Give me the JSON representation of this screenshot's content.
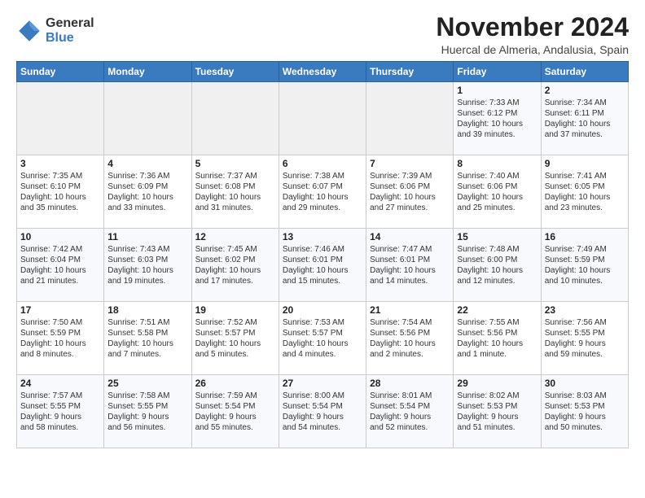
{
  "header": {
    "logo_general": "General",
    "logo_blue": "Blue",
    "month_title": "November 2024",
    "location": "Huercal de Almeria, Andalusia, Spain"
  },
  "days_of_week": [
    "Sunday",
    "Monday",
    "Tuesday",
    "Wednesday",
    "Thursday",
    "Friday",
    "Saturday"
  ],
  "weeks": [
    [
      {
        "day": "",
        "info": ""
      },
      {
        "day": "",
        "info": ""
      },
      {
        "day": "",
        "info": ""
      },
      {
        "day": "",
        "info": ""
      },
      {
        "day": "",
        "info": ""
      },
      {
        "day": "1",
        "info": "Sunrise: 7:33 AM\nSunset: 6:12 PM\nDaylight: 10 hours\nand 39 minutes."
      },
      {
        "day": "2",
        "info": "Sunrise: 7:34 AM\nSunset: 6:11 PM\nDaylight: 10 hours\nand 37 minutes."
      }
    ],
    [
      {
        "day": "3",
        "info": "Sunrise: 7:35 AM\nSunset: 6:10 PM\nDaylight: 10 hours\nand 35 minutes."
      },
      {
        "day": "4",
        "info": "Sunrise: 7:36 AM\nSunset: 6:09 PM\nDaylight: 10 hours\nand 33 minutes."
      },
      {
        "day": "5",
        "info": "Sunrise: 7:37 AM\nSunset: 6:08 PM\nDaylight: 10 hours\nand 31 minutes."
      },
      {
        "day": "6",
        "info": "Sunrise: 7:38 AM\nSunset: 6:07 PM\nDaylight: 10 hours\nand 29 minutes."
      },
      {
        "day": "7",
        "info": "Sunrise: 7:39 AM\nSunset: 6:06 PM\nDaylight: 10 hours\nand 27 minutes."
      },
      {
        "day": "8",
        "info": "Sunrise: 7:40 AM\nSunset: 6:06 PM\nDaylight: 10 hours\nand 25 minutes."
      },
      {
        "day": "9",
        "info": "Sunrise: 7:41 AM\nSunset: 6:05 PM\nDaylight: 10 hours\nand 23 minutes."
      }
    ],
    [
      {
        "day": "10",
        "info": "Sunrise: 7:42 AM\nSunset: 6:04 PM\nDaylight: 10 hours\nand 21 minutes."
      },
      {
        "day": "11",
        "info": "Sunrise: 7:43 AM\nSunset: 6:03 PM\nDaylight: 10 hours\nand 19 minutes."
      },
      {
        "day": "12",
        "info": "Sunrise: 7:45 AM\nSunset: 6:02 PM\nDaylight: 10 hours\nand 17 minutes."
      },
      {
        "day": "13",
        "info": "Sunrise: 7:46 AM\nSunset: 6:01 PM\nDaylight: 10 hours\nand 15 minutes."
      },
      {
        "day": "14",
        "info": "Sunrise: 7:47 AM\nSunset: 6:01 PM\nDaylight: 10 hours\nand 14 minutes."
      },
      {
        "day": "15",
        "info": "Sunrise: 7:48 AM\nSunset: 6:00 PM\nDaylight: 10 hours\nand 12 minutes."
      },
      {
        "day": "16",
        "info": "Sunrise: 7:49 AM\nSunset: 5:59 PM\nDaylight: 10 hours\nand 10 minutes."
      }
    ],
    [
      {
        "day": "17",
        "info": "Sunrise: 7:50 AM\nSunset: 5:59 PM\nDaylight: 10 hours\nand 8 minutes."
      },
      {
        "day": "18",
        "info": "Sunrise: 7:51 AM\nSunset: 5:58 PM\nDaylight: 10 hours\nand 7 minutes."
      },
      {
        "day": "19",
        "info": "Sunrise: 7:52 AM\nSunset: 5:57 PM\nDaylight: 10 hours\nand 5 minutes."
      },
      {
        "day": "20",
        "info": "Sunrise: 7:53 AM\nSunset: 5:57 PM\nDaylight: 10 hours\nand 4 minutes."
      },
      {
        "day": "21",
        "info": "Sunrise: 7:54 AM\nSunset: 5:56 PM\nDaylight: 10 hours\nand 2 minutes."
      },
      {
        "day": "22",
        "info": "Sunrise: 7:55 AM\nSunset: 5:56 PM\nDaylight: 10 hours\nand 1 minute."
      },
      {
        "day": "23",
        "info": "Sunrise: 7:56 AM\nSunset: 5:55 PM\nDaylight: 9 hours\nand 59 minutes."
      }
    ],
    [
      {
        "day": "24",
        "info": "Sunrise: 7:57 AM\nSunset: 5:55 PM\nDaylight: 9 hours\nand 58 minutes."
      },
      {
        "day": "25",
        "info": "Sunrise: 7:58 AM\nSunset: 5:55 PM\nDaylight: 9 hours\nand 56 minutes."
      },
      {
        "day": "26",
        "info": "Sunrise: 7:59 AM\nSunset: 5:54 PM\nDaylight: 9 hours\nand 55 minutes."
      },
      {
        "day": "27",
        "info": "Sunrise: 8:00 AM\nSunset: 5:54 PM\nDaylight: 9 hours\nand 54 minutes."
      },
      {
        "day": "28",
        "info": "Sunrise: 8:01 AM\nSunset: 5:54 PM\nDaylight: 9 hours\nand 52 minutes."
      },
      {
        "day": "29",
        "info": "Sunrise: 8:02 AM\nSunset: 5:53 PM\nDaylight: 9 hours\nand 51 minutes."
      },
      {
        "day": "30",
        "info": "Sunrise: 8:03 AM\nSunset: 5:53 PM\nDaylight: 9 hours\nand 50 minutes."
      }
    ]
  ]
}
